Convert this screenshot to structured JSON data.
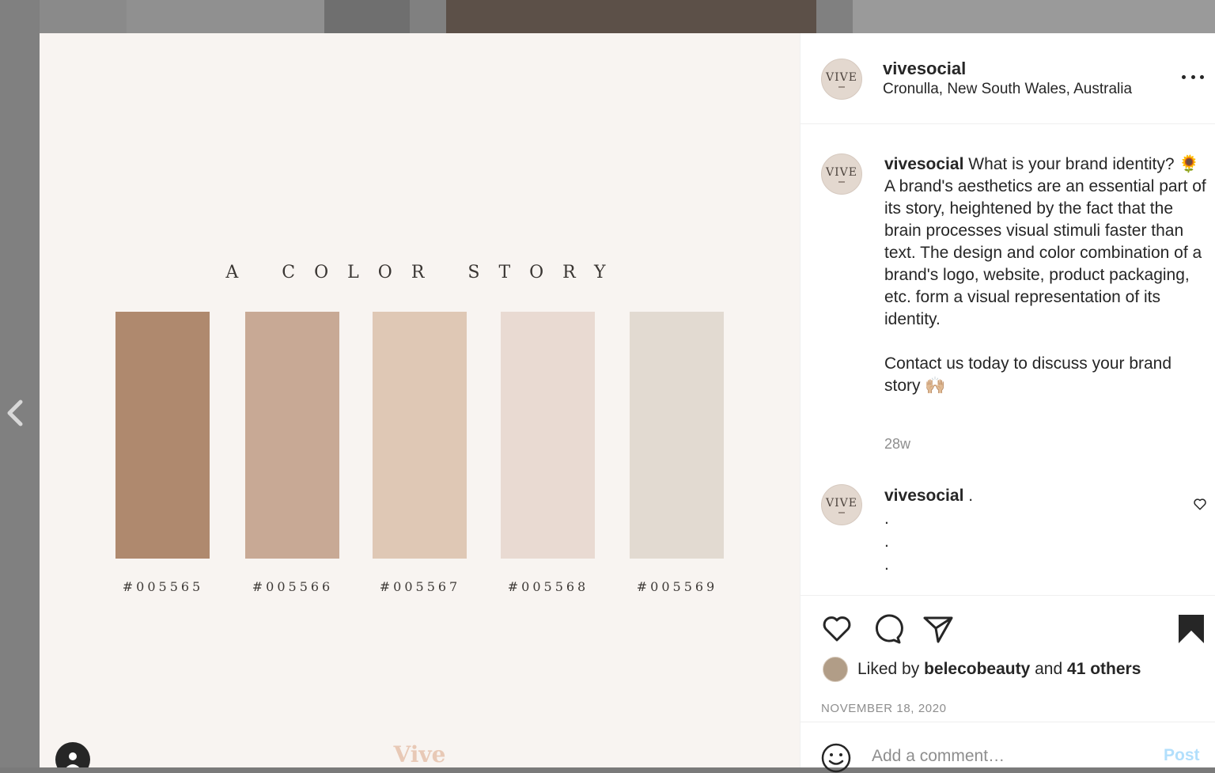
{
  "post": {
    "username": "vivesocial",
    "location": "Cronulla, New South Wales, Australia",
    "avatar_text": "VIVE",
    "caption_text": "What is your brand identity? 🌻 A brand's aesthetics are an essential part of its story, heightened by the fact that the brain processes visual stimuli faster than text. The design and color combination of a brand's logo, website, product packaging, etc. form a visual representation of its identity.\n\nContact us today to discuss your brand story 🙌🏼",
    "timestamp": "28w",
    "comment": {
      "username": "vivesocial",
      "text": ".\n.\n.\n."
    },
    "liked_prefix": "Liked by",
    "liked_user": "belecobeauty",
    "liked_conj": "and",
    "liked_others": "41 others",
    "date": "NOVEMBER 18, 2020",
    "comment_placeholder": "Add a comment…",
    "post_label": "Post"
  },
  "image": {
    "title": "A COLOR STORY",
    "watermark": "Vive",
    "swatches": [
      {
        "label": "#005565",
        "color": "#af896e"
      },
      {
        "label": "#005566",
        "color": "#c8a995"
      },
      {
        "label": "#005567",
        "color": "#dfc8b5"
      },
      {
        "label": "#005568",
        "color": "#e9dad2"
      },
      {
        "label": "#005569",
        "color": "#e2dad1"
      }
    ]
  },
  "icons": {
    "prev": "chevron-left-icon",
    "more": "more-horizontal-icon",
    "like": "heart-icon",
    "comment": "comment-icon",
    "share": "paper-plane-icon",
    "save": "bookmark-filled-icon",
    "emoji": "smiley-icon",
    "user_tag": "user-icon"
  }
}
